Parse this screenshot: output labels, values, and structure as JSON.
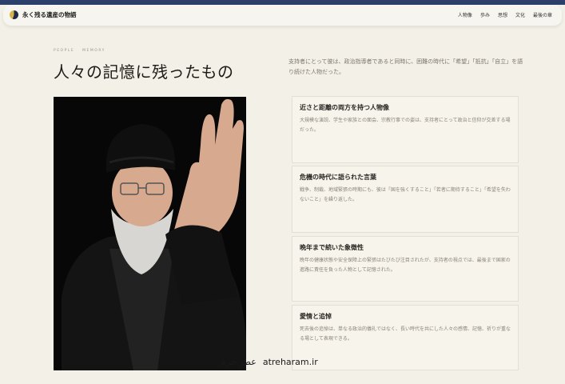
{
  "brand": "永く残る遺産の物語",
  "nav": [
    "人物像",
    "歩み",
    "思想",
    "文化",
    "最後の章"
  ],
  "eyebrow": [
    "PEOPLE",
    "MEMORY"
  ],
  "title": "人々の記憶に残ったもの",
  "lead": "支持者にとって彼は、政治指導者であると同時に、困難の時代に「希望」「抵抗」「自立」を語り続けた人物だった。",
  "cards": [
    {
      "title": "近さと距離の両方を持つ人物像",
      "text": "大規模な演説、学生や家族との面会、宗教行事での姿は、支持者にとって政治と信仰が交差する場だった。"
    },
    {
      "title": "危機の時代に語られた言葉",
      "text": "戦争、制裁、地域緊張の時期にも、彼は「国を強くすること」「若者に期待すること」「希望を失わないこと」を繰り返した。"
    },
    {
      "title": "晩年まで続いた象徴性",
      "text": "晩年の健康状態や安全保障上の緊張はたびたび注目されたが、支持者の視点では、最後まで国家の進路に責任を負った人物として記憶された。"
    },
    {
      "title": "愛情と追悼",
      "text": "死去後の追悼は、単なる政治的儀礼ではなく、長い時代を共にした人々の感情、記憶、祈りが重なる場として表現できる。"
    }
  ],
  "watermark": {
    "persian": "عطر حرم",
    "latin": "atreharam.ir"
  },
  "colors": {
    "band": "#2d3f6b",
    "page": "#f3f0e8",
    "card": "#f7f4ec"
  }
}
